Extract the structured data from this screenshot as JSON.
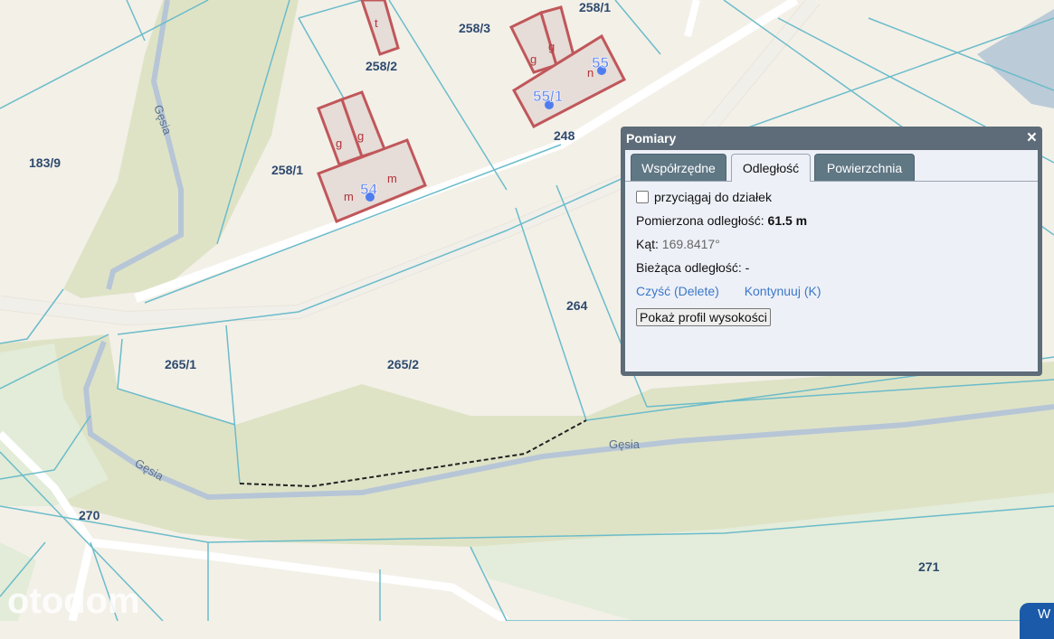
{
  "map": {
    "parcels": [
      "183/9",
      "258/2",
      "258/3",
      "258/1",
      "258/1",
      "248",
      "264",
      "265/1",
      "265/2",
      "270",
      "271"
    ],
    "buildings": [
      "t",
      "g",
      "g",
      "g",
      "g",
      "m",
      "m",
      "n"
    ],
    "numbers": [
      "54",
      "55",
      "55/1"
    ],
    "streams": [
      "Gęsia",
      "Gęsia",
      "Gęsia"
    ],
    "watermark": "otodom"
  },
  "dialog": {
    "title": "Pomiary",
    "close_icon": "×",
    "tabs": [
      {
        "label": "Współrzędne",
        "active": false
      },
      {
        "label": "Odległość",
        "active": true
      },
      {
        "label": "Powierzchnia",
        "active": false
      }
    ],
    "snap_label": "przyciągaj do działek",
    "snap_checked": false,
    "measured_label": "Pomierzona odległość:",
    "measured_value": "61.5 m",
    "angle_label": "Kąt:",
    "angle_value": "169.8417°",
    "current_label": "Bieżąca odległość:",
    "current_value": "-",
    "clear_link": "Czyść (Delete)",
    "continue_link": "Kontynuuj (K)",
    "profile_button": "Pokaż profil wysokości"
  },
  "corner_button": "W"
}
